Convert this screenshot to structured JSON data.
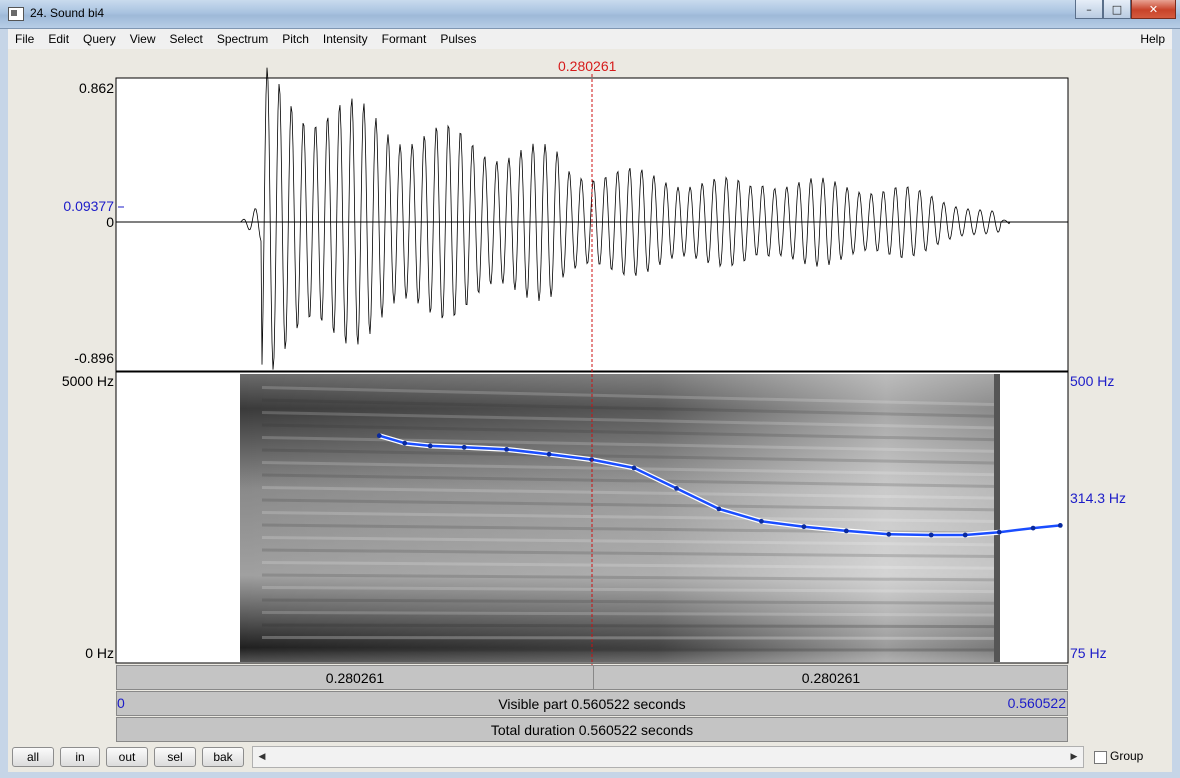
{
  "window": {
    "title": "24. Sound bi4"
  },
  "menu": [
    "File",
    "Edit",
    "Query",
    "View",
    "Select",
    "Spectrum",
    "Pitch",
    "Intensity",
    "Formant",
    "Pulses"
  ],
  "help": "Help",
  "cursor_time": "0.280261",
  "waveform": {
    "max": "0.862",
    "cursor_value": "0.09377",
    "zero": "0",
    "min": "-0.896"
  },
  "spectrogram": {
    "freq_max": "5000 Hz",
    "freq_min": "0 Hz"
  },
  "pitch": {
    "max": "500 Hz",
    "cursor_value": "314.3 Hz",
    "min": "75 Hz"
  },
  "time_bar": {
    "left_segment": "0.280261",
    "right_segment": "0.280261"
  },
  "visible_bar": {
    "start": "0",
    "label": "Visible part 0.560522 seconds",
    "end": "0.560522"
  },
  "total_bar": {
    "label": "Total duration 0.560522 seconds"
  },
  "buttons": {
    "all": "all",
    "in": "in",
    "out": "out",
    "sel": "sel",
    "bak": "bak"
  },
  "group_label": "Group",
  "colors": {
    "pitch_line": "#1a4dff",
    "cursor": "#cc1111",
    "label_blue": "#1c1cc8"
  },
  "chart_data": {
    "type": "line",
    "title": "",
    "xlabel": "",
    "ylabel": "",
    "xlim": [
      0,
      0.560522
    ],
    "ylim": [
      75,
      500
    ],
    "x": [
      0.155,
      0.17,
      0.185,
      0.205,
      0.23,
      0.255,
      0.28,
      0.305,
      0.33,
      0.355,
      0.38,
      0.405,
      0.43,
      0.455,
      0.48,
      0.5,
      0.52,
      0.54,
      0.556
    ],
    "series": [
      {
        "values": [
          407,
          396,
          392,
          390,
          387,
          380,
          372,
          360,
          330,
          300,
          282,
          274,
          268,
          263,
          262,
          262,
          266,
          272,
          276
        ]
      }
    ]
  }
}
